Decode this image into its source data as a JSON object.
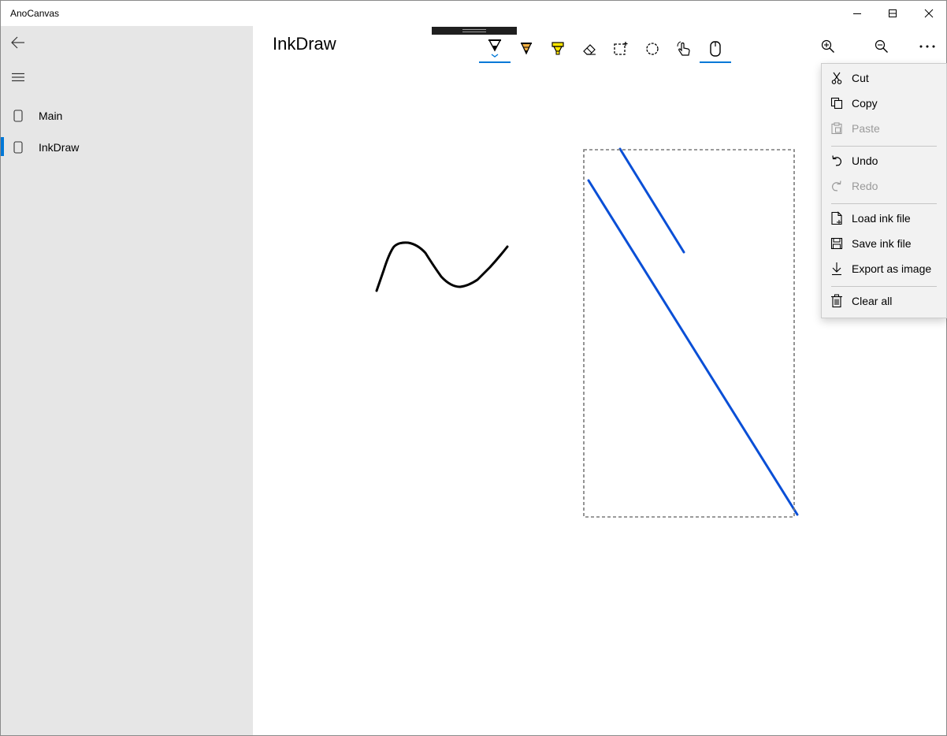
{
  "window": {
    "title": "AnoCanvas",
    "controls": [
      "minimize",
      "maximize",
      "close"
    ]
  },
  "nav": {
    "back_icon": "back-arrow-icon",
    "menu_icon": "hamburger-icon",
    "items": [
      {
        "label": "Main",
        "icon": "page-icon",
        "selected": false
      },
      {
        "label": "InkDraw",
        "icon": "page-icon",
        "selected": true
      }
    ],
    "accent": "#0078d7"
  },
  "page": {
    "title": "InkDraw"
  },
  "ink_toolbar": {
    "tools": [
      {
        "name": "ballpoint-pen",
        "selected": true
      },
      {
        "name": "pencil",
        "selected": false
      },
      {
        "name": "highlighter",
        "selected": false
      },
      {
        "name": "eraser",
        "selected": false
      },
      {
        "name": "rectangle-select",
        "selected": false
      },
      {
        "name": "lasso-select",
        "selected": false
      },
      {
        "name": "touch-writing",
        "selected": false
      },
      {
        "name": "mouse-input",
        "selected": true
      }
    ]
  },
  "commands": [
    "zoom-in-icon",
    "zoom-out-icon",
    "more-icon"
  ],
  "canvas": {
    "strokes": [
      {
        "color": "#000000",
        "kind": "freehand"
      },
      {
        "color": "#0a4fd6",
        "kind": "line"
      },
      {
        "color": "#0a4fd6",
        "kind": "line"
      }
    ],
    "selection_box": true
  },
  "menu": {
    "items": [
      {
        "label": "Cut",
        "icon": "scissors-icon",
        "enabled": true
      },
      {
        "label": "Copy",
        "icon": "copy-icon",
        "enabled": true
      },
      {
        "label": "Paste",
        "icon": "paste-icon",
        "enabled": false
      },
      {
        "label": "Undo",
        "icon": "undo-icon",
        "enabled": true
      },
      {
        "label": "Redo",
        "icon": "redo-icon",
        "enabled": false
      },
      {
        "label": "Load ink file",
        "icon": "file-add-icon",
        "enabled": true
      },
      {
        "label": "Save ink file",
        "icon": "save-icon",
        "enabled": true
      },
      {
        "label": "Export as image",
        "icon": "download-icon",
        "enabled": true
      },
      {
        "label": "Clear all",
        "icon": "trash-icon",
        "enabled": true
      }
    ]
  }
}
